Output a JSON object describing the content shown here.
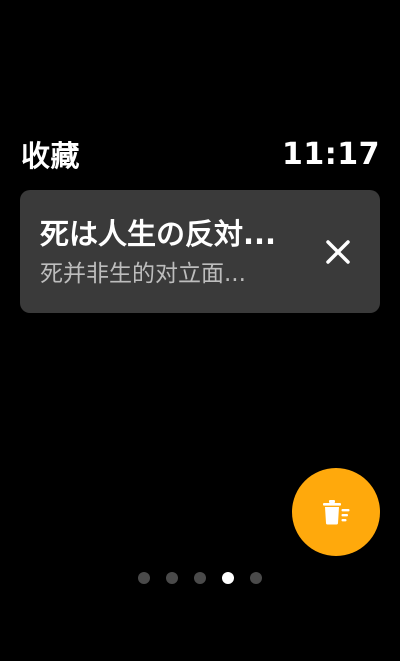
{
  "header": {
    "title": "收藏",
    "time": "11:17"
  },
  "favorites": [
    {
      "title": "死は人生の反対...",
      "subtitle": "死并非生的对立面..."
    }
  ],
  "fab": {
    "icon": "clear-all-delete-icon",
    "color": "#ffa90c"
  },
  "pager": {
    "total": 5,
    "current_index": 3
  }
}
